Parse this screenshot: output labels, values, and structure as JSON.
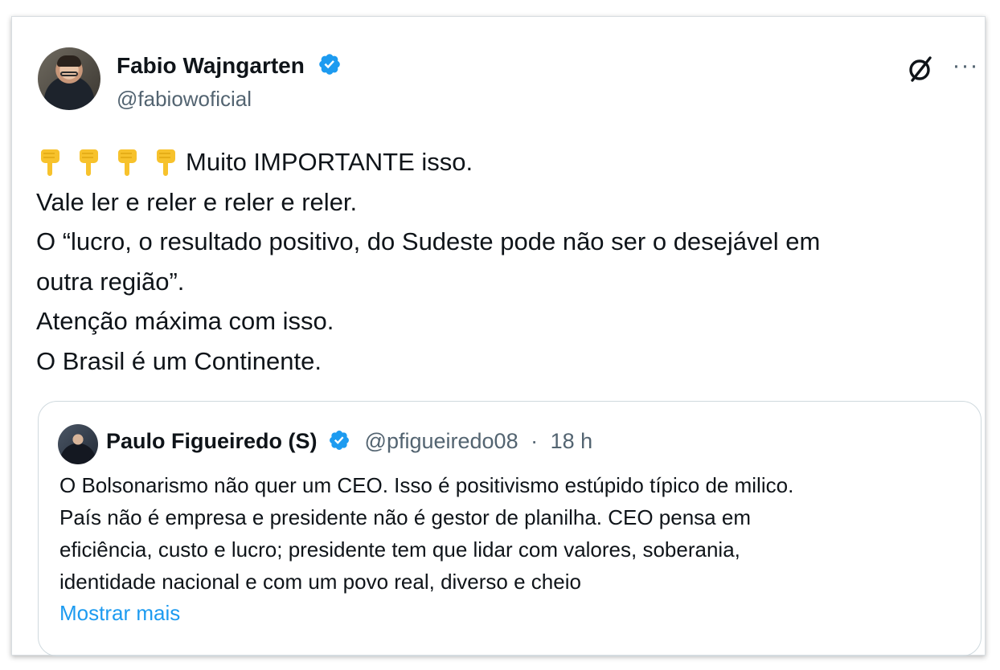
{
  "tweet": {
    "author": {
      "name": "Fabio Wajngarten",
      "handle": "@fabiowoficial",
      "verified": true
    },
    "text_lines": [
      "Muito IMPORTANTE isso.",
      "Vale ler e reler e reler e reler.",
      "O “lucro, o resultado positivo, do Sudeste pode não ser o desejável em",
      "outra região”.",
      "Atenção máxima com isso.",
      "O Brasil é um Continente."
    ],
    "emoji_prefix": {
      "icon": "backhand-index-pointing-down-icon",
      "count": 4
    }
  },
  "quoted_tweet": {
    "author": {
      "name": "Paulo Figueiredo (S)",
      "handle": "@pfigueiredo08",
      "separator": "·",
      "time": "18 h",
      "verified": true
    },
    "text_lines": [
      "O Bolsonarismo não quer um CEO. Isso é positivismo estúpido típico de milico.",
      "País não é empresa e presidente não é gestor de planilha. CEO pensa em",
      "eficiência, custo e lucro; presidente tem que lidar com valores, soberania,",
      "identidade nacional e com um povo real, diverso e cheio"
    ],
    "show_more_label": "Mostrar mais"
  },
  "icons": {
    "grok": "grok-icon",
    "more": "more-options-icon",
    "verified": "verified-badge-icon"
  },
  "colors": {
    "text": "#0f1419",
    "secondary": "#536471",
    "link": "#1d9bf0",
    "verified": "#1d9bf0",
    "border": "#cfd9de",
    "emoji": "#f7c22c"
  }
}
